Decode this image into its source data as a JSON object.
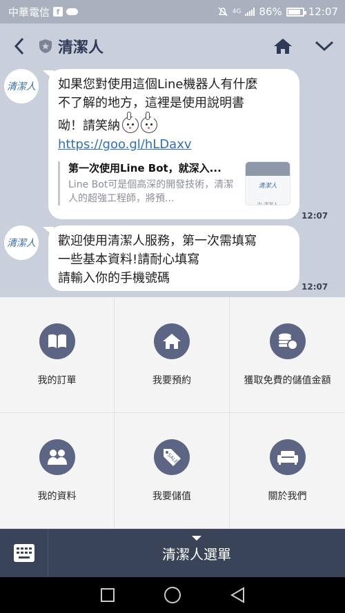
{
  "status_bar": {
    "carrier": "中華電信",
    "network": "4G",
    "battery_percent": "86%",
    "battery_level": 0.86,
    "time": "12:07"
  },
  "header": {
    "title": "清潔人",
    "back_icon": "back-arrow-icon",
    "home_icon": "home-icon",
    "expand_icon": "chevron-down-icon"
  },
  "messages": [
    {
      "sender_avatar_text": "清潔人",
      "lines": [
        "如果您對使用這個Line機器人有什麼",
        "不了解的地方，這裡是使用說明書"
      ],
      "line3": "呦！請笑納",
      "link": "https://goo.gl/hLDaxv",
      "preview": {
        "title": "第一次使用Line Bot，就深入...",
        "description": "Line Bot可是個高深的開發技術，清潔人的超強工程師，將預...",
        "thumb_text": "清潔人",
        "thumb_sub": "中 清潔人"
      },
      "time": "12:07"
    },
    {
      "sender_avatar_text": "清潔人",
      "lines": [
        "歡迎使用清潔人服務，第一次需填寫",
        "一些基本資料!請耐心填寫",
        "請輸入你的手機號碼"
      ],
      "time": "12:07"
    }
  ],
  "rich_menu": {
    "items": [
      {
        "label": "我的訂單",
        "icon": "book-icon"
      },
      {
        "label": "我要預約",
        "icon": "home-icon"
      },
      {
        "label": "獲取免費的儲值金額",
        "icon": "coins-icon"
      },
      {
        "label": "我的資料",
        "icon": "users-icon"
      },
      {
        "label": "我要儲值",
        "icon": "sale-tag-icon"
      },
      {
        "label": "關於我們",
        "icon": "sofa-icon"
      }
    ]
  },
  "bottom_bar": {
    "keyboard_icon": "keyboard-icon",
    "menu_label": "清潔人選單"
  },
  "nav_bar": {
    "icons": [
      "square-icon",
      "circle-icon",
      "back-triangle-icon"
    ]
  },
  "colors": {
    "chat_background": "#c9cfdb",
    "menu_icon_bg": "#5c6584",
    "bottom_bar": "#3a4459",
    "link": "#2f6fc0"
  }
}
